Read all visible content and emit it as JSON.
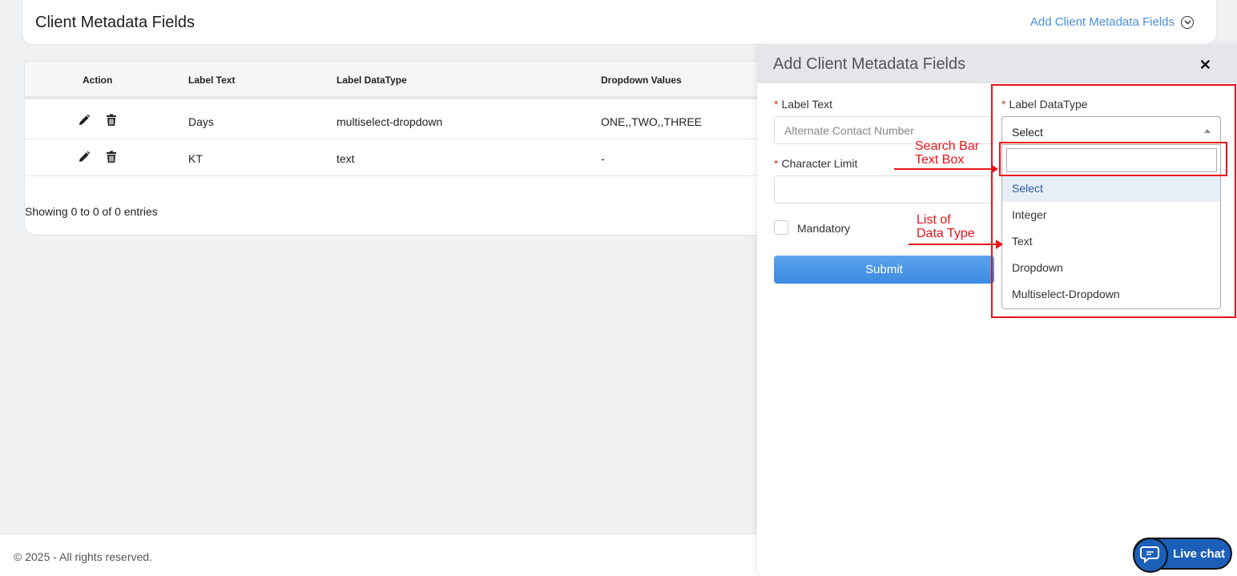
{
  "header": {
    "title": "Client Metadata Fields",
    "add_link": "Add Client Metadata Fields"
  },
  "table": {
    "columns": [
      "Action",
      "Label Text",
      "Label DataType",
      "Dropdown Values"
    ],
    "rows": [
      {
        "label_text": "Days",
        "datatype": "multiselect-dropdown",
        "dropdown_values": "ONE,,TWO,,THREE"
      },
      {
        "label_text": "KT",
        "datatype": "text",
        "dropdown_values": "-"
      }
    ],
    "showing": "Showing 0 to 0 of 0 entries"
  },
  "footer": {
    "copyright": "© 2025 - All rights reserved."
  },
  "panel": {
    "title": "Add Client Metadata Fields",
    "label_text": {
      "label": "Label Text",
      "placeholder": "Alternate Contact Number",
      "required_mark": "*"
    },
    "character_limit": {
      "label": "Character Limit",
      "required_mark": "*"
    },
    "mandatory_label": "Mandatory",
    "submit_label": "Submit",
    "datatype": {
      "label": "Label DataType",
      "required_mark": "*",
      "selected": "Select",
      "options": [
        "Select",
        "Integer",
        "Text",
        "Dropdown",
        "Multiselect-Dropdown"
      ]
    }
  },
  "annotations": {
    "search_bar_line1": "Search Bar",
    "search_bar_line2": "Text Box",
    "list_line1": "List of",
    "list_line2": "Data Type",
    "color": "#e8141b"
  },
  "livechat": {
    "label": "Live chat"
  },
  "colors": {
    "accent": "#4a90d9",
    "submit": "#4a95e6",
    "required": "#d9342b"
  }
}
